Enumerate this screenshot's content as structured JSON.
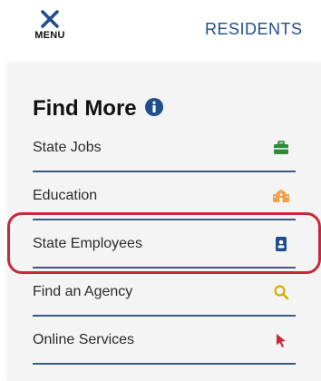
{
  "header": {
    "menu_label": "MENU",
    "residents_label": "RESIDENTS"
  },
  "find_more": {
    "title": "Find More",
    "items": [
      {
        "label": "State Jobs",
        "icon": "briefcase-icon",
        "icon_color": "#2e8b3a"
      },
      {
        "label": "Education",
        "icon": "school-icon",
        "icon_color": "#f0a04b"
      },
      {
        "label": "State Employees",
        "icon": "id-badge-icon",
        "icon_color": "#1f4e8c"
      },
      {
        "label": "Find an Agency",
        "icon": "search-icon",
        "icon_color": "#d4b000"
      },
      {
        "label": "Online Services",
        "icon": "cursor-icon",
        "icon_color": "#c8283c"
      }
    ]
  },
  "colors": {
    "brand_blue": "#1f4e8c",
    "divider": "#3b5a8a",
    "highlight_red": "#c8283c"
  }
}
